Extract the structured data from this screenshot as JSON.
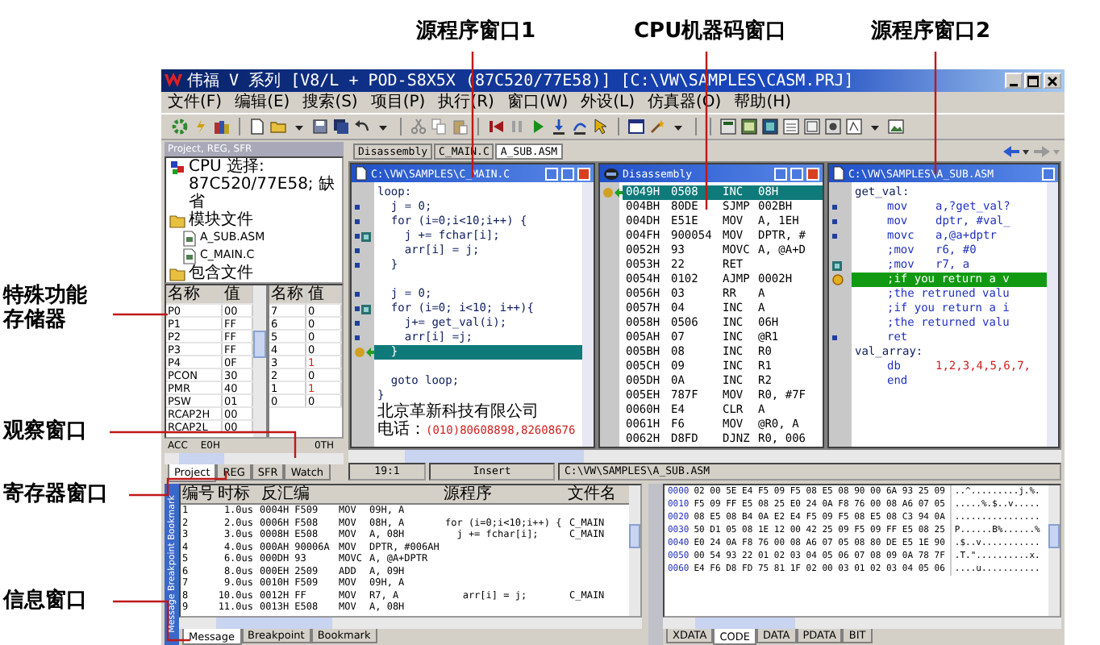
{
  "callouts_top": [
    "源程序窗口1",
    "CPU机器码窗口",
    "源程序窗口2"
  ],
  "callouts_left": [
    "特殊功能存储器",
    "观察窗口",
    "寄存器窗口",
    "信息窗口"
  ],
  "window": {
    "title": "伟福 V 系列 [V8/L  + POD-S8X5X (87C520/77E58)] [C:\\VW\\SAMPLES\\CASM.PRJ]"
  },
  "menu": [
    "文件(F)",
    "编辑(E)",
    "搜索(S)",
    "项目(P)",
    "执行(R)",
    "窗口(W)",
    "外设(L)",
    "仿真器(O)",
    "帮助(H)"
  ],
  "project_panel": {
    "title": "Project, REG, SFR",
    "tree": [
      {
        "kind": "cpu",
        "label": "CPU 选择: 87C520/77E58;  缺省"
      },
      {
        "kind": "folder",
        "label": "模块文件",
        "children": [
          {
            "kind": "file",
            "label": "A_SUB.ASM"
          },
          {
            "kind": "file",
            "label": "C_MAIN.C"
          }
        ]
      },
      {
        "kind": "folder",
        "label": "包含文件"
      }
    ],
    "sfr": {
      "columns": [
        "名称",
        "值"
      ],
      "rows": [
        [
          "P0",
          "00"
        ],
        [
          "P1",
          "FF"
        ],
        [
          "P2",
          "FF"
        ],
        [
          "P3",
          "FF"
        ],
        [
          "P4",
          "0F"
        ],
        [
          "PCON",
          "30"
        ],
        [
          "PMR",
          "40"
        ],
        [
          "PSW",
          "01"
        ],
        [
          "RCAP2H",
          "00"
        ],
        [
          "RCAP2L",
          "00"
        ]
      ]
    },
    "bits": {
      "columns": [
        "名称",
        "值"
      ],
      "rows": [
        {
          "name": "7",
          "value": "0",
          "changed": false
        },
        {
          "name": "6",
          "value": "0",
          "changed": false
        },
        {
          "name": "5",
          "value": "0",
          "changed": false
        },
        {
          "name": "4",
          "value": "0",
          "changed": false
        },
        {
          "name": "3",
          "value": "1",
          "changed": true
        },
        {
          "name": "2",
          "value": "0",
          "changed": false
        },
        {
          "name": "1",
          "value": "1",
          "changed": true
        },
        {
          "name": "0",
          "value": "0",
          "changed": false
        }
      ]
    },
    "register": {
      "name": "ACC",
      "value": "E0H",
      "bits": "0TH"
    },
    "tabs": [
      {
        "label": "Project",
        "selected": true
      },
      {
        "label": "REG",
        "selected": false
      },
      {
        "label": "SFR",
        "selected": false
      },
      {
        "label": "Watch",
        "selected": false
      }
    ]
  },
  "mdi_tabs": [
    {
      "label": "Disassembly",
      "selected": false
    },
    {
      "label": "C_MAIN.C",
      "selected": false
    },
    {
      "label": "A_SUB.ASM",
      "selected": true
    }
  ],
  "source1": {
    "title": "C:\\VW\\SAMPLES\\C_MAIN.C",
    "lines": [
      {
        "kind": "code",
        "text": "loop:",
        "dot": false,
        "square": false,
        "current": false
      },
      {
        "kind": "code",
        "text": "  j = 0;",
        "dot": true,
        "square": false,
        "current": false
      },
      {
        "kind": "code",
        "text": "  for (i=0;i<10;i++) {",
        "dot": true,
        "square": false,
        "current": false
      },
      {
        "kind": "code",
        "text": "    j += fchar[i];",
        "dot": true,
        "square": true,
        "current": false
      },
      {
        "kind": "code",
        "text": "    arr[i] = j;",
        "dot": true,
        "square": false,
        "current": false
      },
      {
        "kind": "code",
        "text": "  }",
        "dot": true,
        "square": false,
        "current": false
      },
      {
        "kind": "blank",
        "dot": false,
        "square": false,
        "current": false
      },
      {
        "kind": "code",
        "text": "  j = 0;",
        "dot": true,
        "square": false,
        "current": false
      },
      {
        "kind": "code",
        "text": "  for (i=0; i<10; i++){",
        "dot": true,
        "square": true,
        "current": false
      },
      {
        "kind": "code",
        "text": "    j+= get_val(i);",
        "dot": true,
        "square": false,
        "current": false
      },
      {
        "kind": "code",
        "text": "    arr[i] =j;",
        "dot": true,
        "square": false,
        "current": false
      },
      {
        "kind": "code",
        "text": "  }",
        "dot": false,
        "square": false,
        "current": true
      },
      {
        "kind": "blank",
        "dot": false,
        "square": false,
        "current": false
      },
      {
        "kind": "code",
        "text": "  goto loop;",
        "dot": false,
        "square": false,
        "current": false
      },
      {
        "kind": "code",
        "text": "}",
        "dot": false,
        "square": false,
        "current": false
      },
      {
        "kind": "note",
        "text": "北京革新科技有限公司",
        "dot": false,
        "square": false,
        "current": false
      },
      {
        "kind": "note",
        "text": "电话：",
        "phone": "(010)80608898,82608676",
        "dot": false,
        "square": false,
        "current": false
      }
    ]
  },
  "disassembly": {
    "title": "Disassembly",
    "lines": [
      {
        "addr": "0049H",
        "bytes": "0508",
        "op": "INC",
        "arg": "08H",
        "current": true
      },
      {
        "addr": "004BH",
        "bytes": "80DE",
        "op": "SJMP",
        "arg": "002BH",
        "current": false
      },
      {
        "addr": "004DH",
        "bytes": "E51E",
        "op": "MOV",
        "arg": "A, 1EH",
        "current": false
      },
      {
        "addr": "004FH",
        "bytes": "900054",
        "op": "MOV",
        "arg": "DPTR, #",
        "current": false
      },
      {
        "addr": "0052H",
        "bytes": "93",
        "op": "MOVC",
        "arg": "A, @A+D",
        "current": false
      },
      {
        "addr": "0053H",
        "bytes": "22",
        "op": "RET",
        "current": false
      },
      {
        "addr": "0054H",
        "bytes": "0102",
        "op": "AJMP",
        "arg": "0002H",
        "current": false
      },
      {
        "addr": "0056H",
        "bytes": "03",
        "op": "RR",
        "arg": "A",
        "current": false
      },
      {
        "addr": "0057H",
        "bytes": "04",
        "op": "INC",
        "arg": "A",
        "current": false
      },
      {
        "addr": "0058H",
        "bytes": "0506",
        "op": "INC",
        "arg": "06H",
        "current": false
      },
      {
        "addr": "005AH",
        "bytes": "07",
        "op": "INC",
        "arg": "@R1",
        "current": false
      },
      {
        "addr": "005BH",
        "bytes": "08",
        "op": "INC",
        "arg": "R0",
        "current": false
      },
      {
        "addr": "005CH",
        "bytes": "09",
        "op": "INC",
        "arg": "R1",
        "current": false
      },
      {
        "addr": "005DH",
        "bytes": "0A",
        "op": "INC",
        "arg": "R2",
        "current": false
      },
      {
        "addr": "005EH",
        "bytes": "787F",
        "op": "MOV",
        "arg": "R0, #7F",
        "current": false
      },
      {
        "addr": "0060H",
        "bytes": "E4",
        "op": "CLR",
        "arg": "A",
        "current": false
      },
      {
        "addr": "0061H",
        "bytes": "F6",
        "op": "MOV",
        "arg": "@R0, A",
        "current": false
      },
      {
        "addr": "0062H",
        "bytes": "D8FD",
        "op": "DJNZ",
        "arg": "R0, 006",
        "current": false
      }
    ]
  },
  "source2": {
    "title": "C:\\VW\\SAMPLES\\A_SUB.ASM",
    "lines": [
      {
        "kind": "label",
        "text": "get_val:",
        "dot": false,
        "square": false,
        "current": false
      },
      {
        "kind": "instr",
        "op": "mov",
        "arg": "a,?get_val?",
        "dot": true,
        "square": false,
        "current": false
      },
      {
        "kind": "instr",
        "op": "mov",
        "arg": "dptr, #val_",
        "dot": true,
        "square": false,
        "current": false
      },
      {
        "kind": "instr",
        "op": "movc",
        "arg": "a,@a+dptr",
        "dot": true,
        "square": false,
        "current": false
      },
      {
        "kind": "instr",
        "op": ";mov",
        "arg": "r6, #0",
        "dot": false,
        "square": false,
        "current": false
      },
      {
        "kind": "instr",
        "op": ";mov",
        "arg": "r7, a",
        "dot": false,
        "square": true,
        "current": false
      },
      {
        "kind": "comment",
        "text": ";if you return a v",
        "dot": false,
        "square": false,
        "current": true
      },
      {
        "kind": "comment",
        "text": ";the retruned valu",
        "dot": false,
        "square": false,
        "current": false
      },
      {
        "kind": "comment",
        "text": ";if you return a i",
        "dot": false,
        "square": false,
        "current": false
      },
      {
        "kind": "comment",
        "text": ";the returned valu",
        "dot": false,
        "square": false,
        "current": false
      },
      {
        "kind": "instr",
        "op": "ret",
        "dot": true,
        "square": false,
        "current": false
      },
      {
        "kind": "label",
        "text": "val_array:",
        "dot": false,
        "square": false,
        "current": false
      },
      {
        "kind": "data",
        "op": "db",
        "arg": "1,2,3,4,5,6,7,",
        "dot": false,
        "square": false,
        "current": false
      },
      {
        "kind": "instr",
        "op": "end",
        "dot": false,
        "square": false,
        "current": false
      }
    ]
  },
  "status_bar": [
    "19:1",
    "Insert",
    "C:\\VW\\SAMPLES\\A_SUB.ASM"
  ],
  "messages": {
    "dock_label": "Message  Breakpoint  Bookmark",
    "columns": [
      "编号",
      "时标",
      "反汇编",
      "源程序",
      "文件名"
    ],
    "rows": [
      {
        "no": "1",
        "time": "1.0us",
        "code": "0004H F509",
        "op": "MOV",
        "arg": "09H, A"
      },
      {
        "no": "2",
        "time": "2.0us",
        "code": "0006H F508",
        "op": "MOV",
        "arg": "08H, A",
        "source": "for (i=0;i<10;i++) {",
        "file": "C_MAIN"
      },
      {
        "no": "3",
        "time": "3.0us",
        "code": "0008H E508",
        "op": "MOV",
        "arg": "A, 08H",
        "source": "  j += fchar[i];",
        "file": "C_MAIN"
      },
      {
        "no": "4",
        "time": "4.0us",
        "code": "000AH 90006A",
        "op": "MOV",
        "arg": "DPTR, #006AH"
      },
      {
        "no": "5",
        "time": "6.0us",
        "code": "000DH 93",
        "op": "MOVC",
        "arg": "A, @A+DPTR"
      },
      {
        "no": "6",
        "time": "8.0us",
        "code": "000EH 2509",
        "op": "ADD",
        "arg": "A, 09H"
      },
      {
        "no": "7",
        "time": "9.0us",
        "code": "0010H F509",
        "op": "MOV",
        "arg": "09H, A"
      },
      {
        "no": "8",
        "time": "10.0us",
        "code": "0012H FF",
        "op": "MOV",
        "arg": "R7, A",
        "source": "   arr[i] = j;",
        "file": "C_MAIN"
      },
      {
        "no": "9",
        "time": "11.0us",
        "code": "0013H E508",
        "op": "MOV",
        "arg": "A, 08H"
      }
    ],
    "tabs": [
      {
        "label": "Message",
        "selected": true
      },
      {
        "label": "Breakpoint",
        "selected": false
      },
      {
        "label": "Bookmark",
        "selected": false
      }
    ]
  },
  "memory": {
    "rows": [
      {
        "addr": "0000",
        "hex": "02 00 5E E4 F5 09 F5 08 E5 08 90 00 6A 93 25 09",
        "ascii": "..^.........j.%."
      },
      {
        "addr": "0010",
        "hex": "F5 09 FF E5 08 25 E0 24 0A F8 76 00 08 A6 07 05",
        "ascii": ".....%.$..v....."
      },
      {
        "addr": "0020",
        "hex": "08 E5 08 B4 0A E2 E4 F5 09 F5 08 E5 08 C3 94 0A",
        "ascii": "................"
      },
      {
        "addr": "0030",
        "hex": "50 D1 05 08 1E 12 00 42 25 09 F5 09 FF E5 08 25",
        "ascii": "P......B%......%"
      },
      {
        "addr": "0040",
        "hex": "E0 24 0A F8 76 00 08 A6 07 05 08 80 DE E5 1E 90",
        "ascii": ".$..v..........."
      },
      {
        "addr": "0050",
        "hex": "00 54 93 22 01 02 03 04 05 06 07 08 09 0A 78 7F",
        "ascii": ".T.\"..........x."
      },
      {
        "addr": "0060",
        "hex": "E4 F6 D8 FD 75 81 1F 02 00 03 01 02 03 04 05 06",
        "ascii": "....u..........."
      }
    ],
    "tabs": [
      {
        "label": "XDATA",
        "selected": false
      },
      {
        "label": "CODE",
        "selected": true
      },
      {
        "label": "DATA",
        "selected": false
      },
      {
        "label": "PDATA",
        "selected": false
      },
      {
        "label": "BIT",
        "selected": false
      }
    ]
  }
}
